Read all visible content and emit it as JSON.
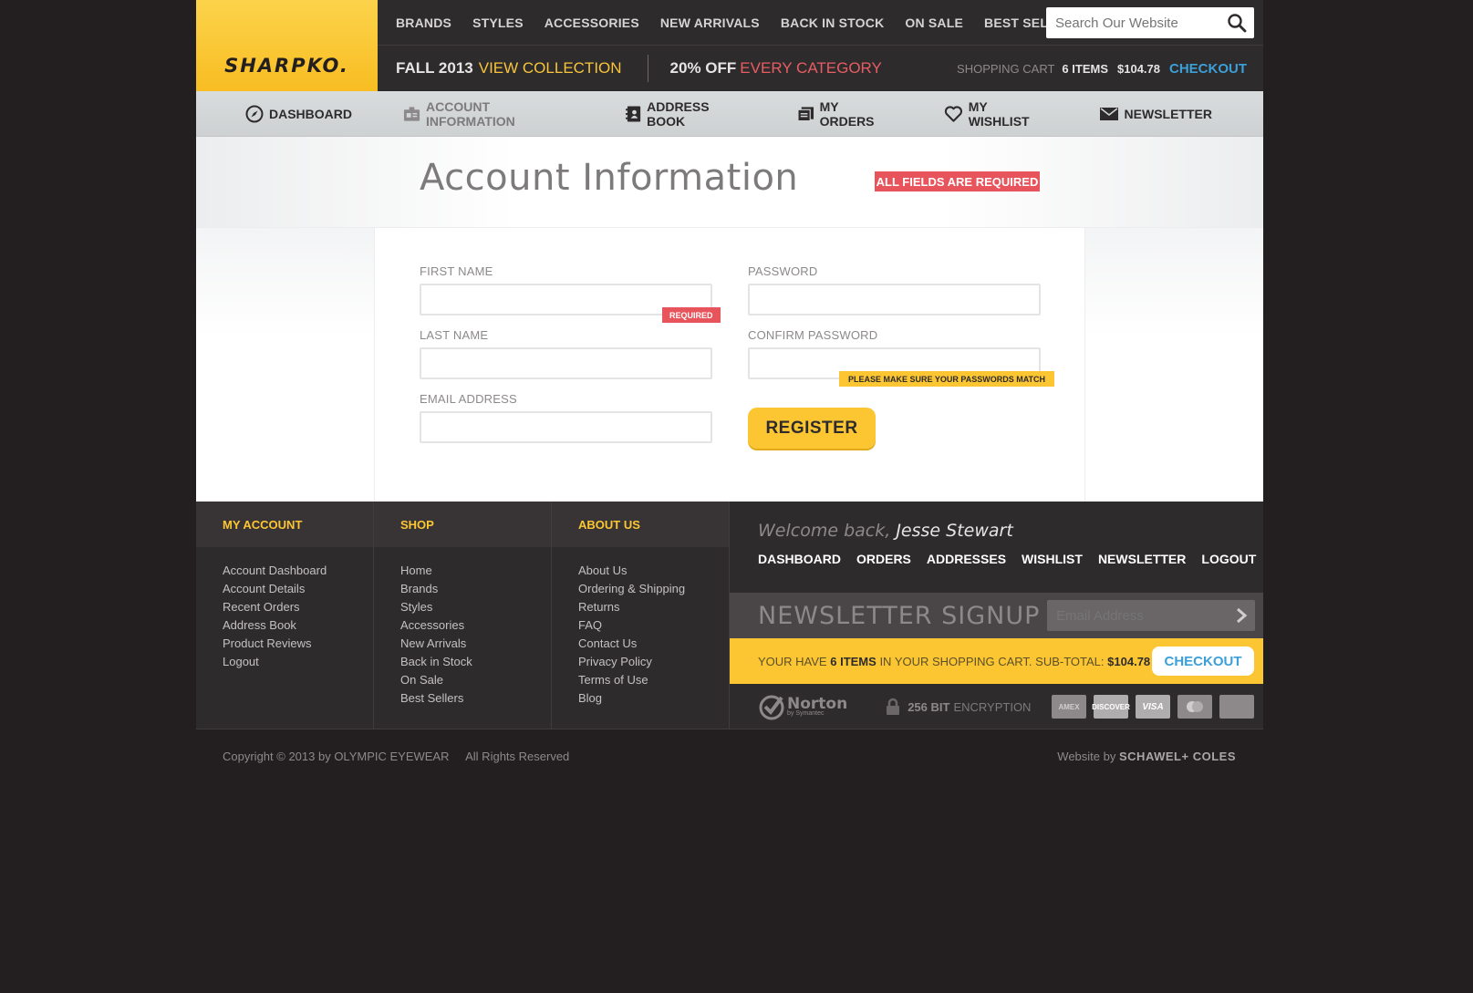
{
  "brand": "SHARPKO.",
  "topnav": [
    "BRANDS",
    "STYLES",
    "ACCESSORIES",
    "NEW ARRIVALS",
    "BACK IN STOCK",
    "ON SALE",
    "BEST SELLERS"
  ],
  "search": {
    "placeholder": "Search Our Website"
  },
  "promo": {
    "fall": "FALL 2013",
    "view": "VIEW COLLECTION",
    "off": "20% OFF",
    "every": "EVERY CATEGORY"
  },
  "cart": {
    "label": "SHOPPING CART",
    "items": "6 ITEMS",
    "total": "$104.78",
    "checkout": "CHECKOUT"
  },
  "account_nav": [
    "DASHBOARD",
    "ACCOUNT INFORMATION",
    "ADDRESS BOOK",
    "MY ORDERS",
    "MY WISHLIST",
    "NEWSLETTER"
  ],
  "page": {
    "title": "Account Information",
    "required_badge": "ALL FIELDS ARE REQUIRED"
  },
  "form": {
    "first_name": "FIRST NAME",
    "last_name": "LAST NAME",
    "email": "EMAIL ADDRESS",
    "password": "PASSWORD",
    "confirm_password": "CONFIRM PASSWORD",
    "required_tag": "REQUIRED",
    "match_tag": "PLEASE MAKE SURE YOUR PASSWORDS MATCH",
    "register": "REGISTER"
  },
  "footer": {
    "my_account": {
      "title": "MY ACCOUNT",
      "links": [
        "Account Dashboard",
        "Account Details",
        "Recent Orders",
        "Address Book",
        "Product Reviews",
        "Logout"
      ]
    },
    "shop": {
      "title": "SHOP",
      "links": [
        "Home",
        "Brands",
        "Styles",
        "Accessories",
        "New Arrivals",
        "Back in Stock",
        "On Sale",
        "Best Sellers"
      ]
    },
    "about": {
      "title": "ABOUT US",
      "links": [
        "About Us",
        "Ordering & Shipping",
        "Returns",
        "FAQ",
        "Contact Us",
        "Privacy Policy",
        "Terms of Use",
        "Blog"
      ]
    },
    "welcome_prefix": "Welcome back,",
    "welcome_name": "Jesse Stewart",
    "nav": [
      "DASHBOARD",
      "ORDERS",
      "ADDRESSES",
      "WISHLIST",
      "NEWSLETTER",
      "LOGOUT"
    ],
    "newsletter_title": "NEWSLETTER SIGNUP",
    "newsletter_placeholder": "Email Address",
    "cart_text_1": "YOUR HAVE",
    "cart_items": "6 ITEMS",
    "cart_text_2": "IN YOUR SHOPPING CART. SUB-TOTAL:",
    "cart_total": "$104.78",
    "checkout": "CHECKOUT",
    "norton": "Norton",
    "norton_sub": "by Symantec",
    "encryption_bold": "256 BIT",
    "encryption": "ENCRYPTION",
    "cards": [
      "AMEX",
      "DISCOVER",
      "VISA",
      "",
      ""
    ]
  },
  "copyright": "Copyright © 2013 by OLYMPIC EYEWEAR",
  "rights": "All Rights Reserved",
  "website_by": "Website by",
  "agency": "SCHAWEL+ COLES",
  "colors": {
    "brand_yellow": "#fcc633",
    "dark_bg": "#231f20",
    "alert_red": "#e8545b",
    "link_blue": "#3ba0d9"
  }
}
